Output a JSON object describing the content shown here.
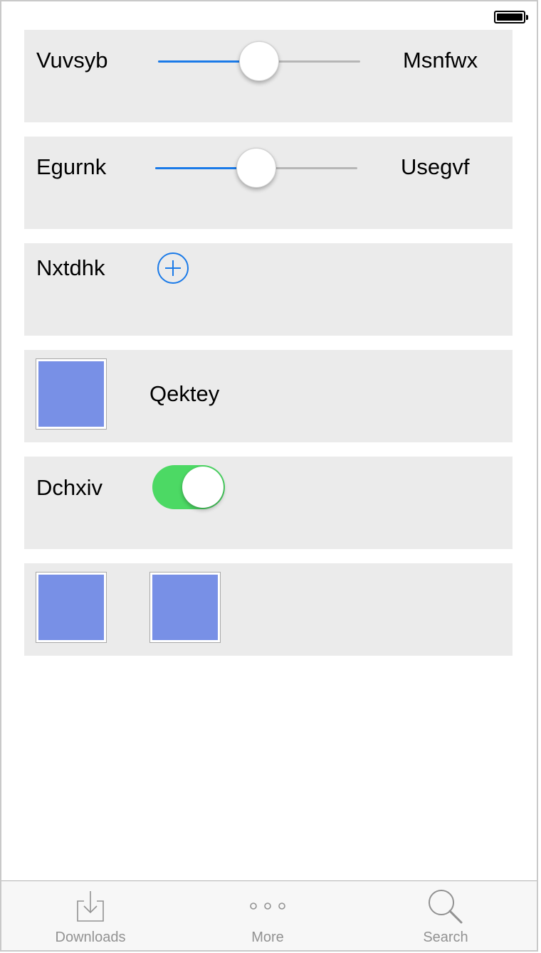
{
  "status_bar": {
    "battery_icon": "battery-full-icon"
  },
  "rows": {
    "slider1": {
      "left_label": "Vuvsyb",
      "right_label": "Msnfwx",
      "value_fraction": 0.5
    },
    "slider2": {
      "left_label": "Egurnk",
      "right_label": "Usegvf",
      "value_fraction": 0.5
    },
    "add_row": {
      "label": "Nxtdhk",
      "icon": "plus-circle-icon"
    },
    "image_row": {
      "label": "Qektey",
      "image_color": "#7890e6"
    },
    "toggle_row": {
      "label": "Dchxiv",
      "on": true,
      "on_color": "#4cd964"
    },
    "images_row": {
      "count": 2,
      "image_color": "#7890e6"
    }
  },
  "tab_bar": {
    "tabs": [
      {
        "label": "Downloads",
        "icon": "downloads-icon"
      },
      {
        "label": "More",
        "icon": "more-icon"
      },
      {
        "label": "Search",
        "icon": "search-icon"
      }
    ]
  },
  "colors": {
    "accent": "#1a7ae8",
    "row_background": "#ebebeb",
    "tab_label": "#929292"
  }
}
